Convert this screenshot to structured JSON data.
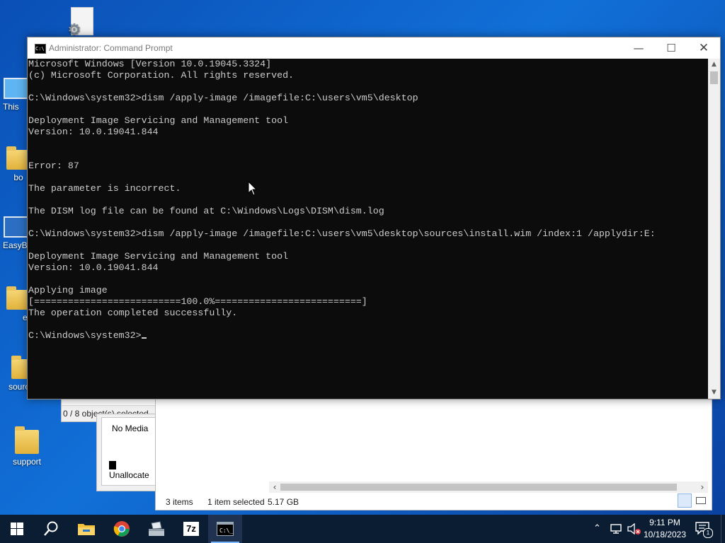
{
  "desktop": {
    "icons": [
      {
        "label": "",
        "kind": "file-gear"
      },
      {
        "label": "This",
        "kind": "pc"
      },
      {
        "label": "bo",
        "kind": "folder"
      },
      {
        "label": "EasyB",
        "kind": "easy"
      },
      {
        "label": "e",
        "kind": "folder"
      },
      {
        "label": "sources",
        "kind": "folder"
      },
      {
        "label": "support",
        "kind": "folder"
      }
    ]
  },
  "explorer_back": {
    "status": "0 / 8 object(s) selected"
  },
  "disk_management": {
    "no_media": "No Media",
    "unallocated": "Unallocate"
  },
  "explorer_front": {
    "items_count": "3 items",
    "selected": "1 item selected",
    "size": "5.17 GB"
  },
  "cmd": {
    "title": "Administrator: Command Prompt",
    "icon_text": "C:\\",
    "lines": [
      "Microsoft Windows [Version 10.0.19045.3324]",
      "(c) Microsoft Corporation. All rights reserved.",
      "",
      "C:\\Windows\\system32>dism /apply-image /imagefile:C:\\users\\vm5\\desktop",
      "",
      "Deployment Image Servicing and Management tool",
      "Version: 10.0.19041.844",
      "",
      "",
      "Error: 87",
      "",
      "The parameter is incorrect.",
      "",
      "The DISM log file can be found at C:\\Windows\\Logs\\DISM\\dism.log",
      "",
      "C:\\Windows\\system32>dism /apply-image /imagefile:C:\\users\\vm5\\desktop\\sources\\install.wim /index:1 /applydir:E:",
      "",
      "Deployment Image Servicing and Management tool",
      "Version: 10.0.19041.844",
      "",
      "Applying image",
      "[==========================100.0%==========================]",
      "The operation completed successfully.",
      "",
      "C:\\Windows\\system32>"
    ]
  },
  "taskbar": {
    "apps": [
      "start",
      "search",
      "file-explorer",
      "chrome",
      "installer",
      "7zip",
      "command-prompt"
    ],
    "time": "9:11 PM",
    "date": "10/18/2023",
    "notification_count": "1"
  }
}
